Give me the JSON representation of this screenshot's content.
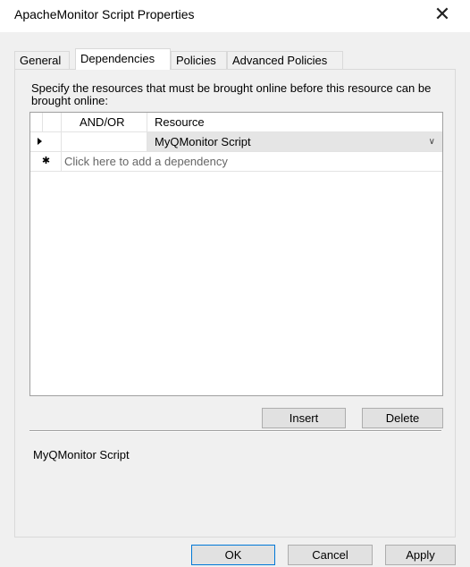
{
  "window": {
    "title": "ApacheMonitor Script Properties",
    "close_glyph": "✕"
  },
  "tabs": [
    {
      "label": "General"
    },
    {
      "label": "Dependencies"
    },
    {
      "label": "Policies"
    },
    {
      "label": "Advanced Policies"
    }
  ],
  "dependencies": {
    "instructions": "Specify the resources that must be brought online before this resource can be brought online:",
    "columns": {
      "and_or": "AND/OR",
      "resource": "Resource"
    },
    "rows": [
      {
        "and_or": "",
        "resource": "MyQMonitor Script"
      }
    ],
    "new_row": {
      "marker": "✱",
      "placeholder": "Click here to add a dependency"
    },
    "insert_label": "Insert",
    "delete_label": "Delete",
    "selected_resource": "MyQMonitor Script"
  },
  "footer": {
    "ok_label": "OK",
    "cancel_label": "Cancel",
    "apply_label": "Apply"
  }
}
